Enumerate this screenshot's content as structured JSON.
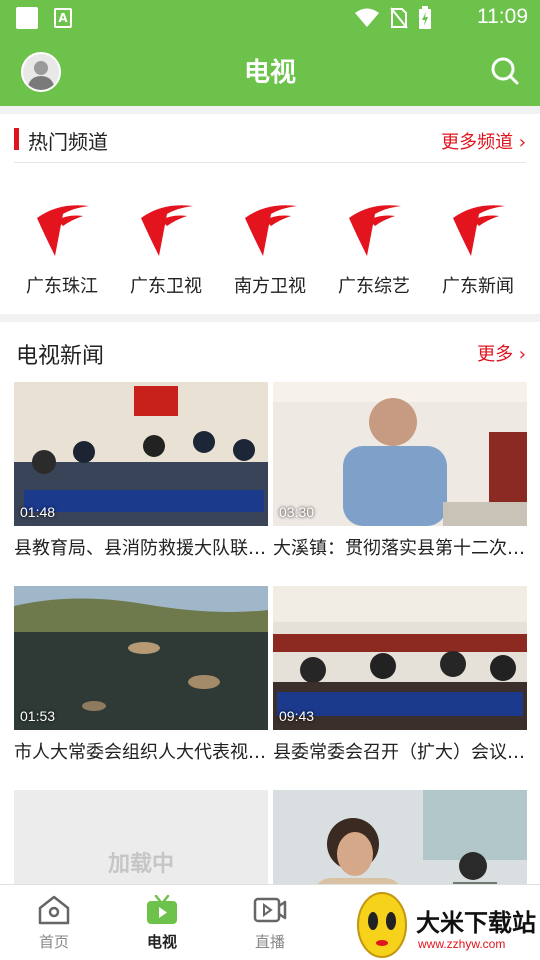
{
  "status_bar": {
    "time": "11:09",
    "app_badge": "A"
  },
  "header": {
    "title": "电视"
  },
  "hot_channels": {
    "title": "热门频道",
    "more_label": "更多频道 ›",
    "channels": [
      {
        "label": "广东珠江"
      },
      {
        "label": "广东卫视"
      },
      {
        "label": "南方卫视"
      },
      {
        "label": "广东综艺"
      },
      {
        "label": "广东新闻"
      }
    ]
  },
  "tv_news": {
    "title": "电视新闻",
    "more_label": "更多 ›",
    "items": [
      {
        "title": "县教育局、县消防救援大队联合开展…",
        "duration": "01:48"
      },
      {
        "title": "大溪镇：贯彻落实县第十二次党代会…",
        "duration": "03:30"
      },
      {
        "title": "市人大常委会组织人大代表视察…",
        "duration": "01:53"
      },
      {
        "title": "县委常委会召开（扩大）会议…",
        "duration": "09:43"
      },
      {
        "title": "",
        "duration": "",
        "loading_text": "加载中"
      },
      {
        "title": "",
        "duration": ""
      }
    ]
  },
  "bottom_nav": {
    "tabs": [
      {
        "label": "首页"
      },
      {
        "label": "电视"
      },
      {
        "label": "直播"
      }
    ]
  },
  "watermark": {
    "text": "大米下载站",
    "url": "www.zzhyw.com"
  },
  "colors": {
    "brand_green": "#6cc24a",
    "accent_red": "#e0141e"
  }
}
